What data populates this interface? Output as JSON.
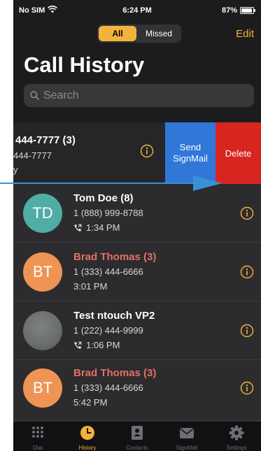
{
  "status": {
    "carrier": "No SIM",
    "time": "6:24 PM",
    "battery": "87%"
  },
  "header": {
    "segment_all": "All",
    "segment_missed": "Missed",
    "edit": "Edit",
    "title": "Call History"
  },
  "search": {
    "placeholder": "Search",
    "value": ""
  },
  "swiped_row": {
    "name": "444-7777 (3)",
    "number": "444-7777",
    "meta": "y",
    "send_label_1": "Send",
    "send_label_2": "SignMail",
    "delete_label": "Delete"
  },
  "calls": [
    {
      "initials": "TD",
      "name": "Tom Doe (8)",
      "number": "1 (888) 999-8788",
      "time": "1:34 PM",
      "missed": false,
      "outgoing": true,
      "avatar_color": "#4fada6"
    },
    {
      "initials": "BT",
      "name": "Brad Thomas (3)",
      "number": "1 (333) 444-6666",
      "time": "3:01 PM",
      "missed": true,
      "outgoing": false,
      "avatar_color": "#ef9455"
    },
    {
      "initials": "",
      "name": "Test ntouch VP2",
      "number": "1 (222) 444-9999",
      "time": "1:06 PM",
      "missed": false,
      "outgoing": true,
      "avatar_color": "#6a6e6b"
    },
    {
      "initials": "BT",
      "name": "Brad Thomas (3)",
      "number": "1 (333) 444-6666",
      "time": "5:42 PM",
      "missed": true,
      "outgoing": false,
      "avatar_color": "#ef9455"
    }
  ],
  "tabs": [
    {
      "label": "Dial",
      "icon": "dialpad-icon",
      "active": false
    },
    {
      "label": "History",
      "icon": "clock-icon",
      "active": true
    },
    {
      "label": "Contacts",
      "icon": "contacts-icon",
      "active": false
    },
    {
      "label": "SignMail",
      "icon": "envelope-icon",
      "active": false
    },
    {
      "label": "Settings",
      "icon": "gear-icon",
      "active": false
    }
  ],
  "colors": {
    "accent": "#f2b33d",
    "missed": "#e46f66",
    "send_button": "#3077d8",
    "delete_button": "#d7261f",
    "callout_arrow": "#3a8fd9"
  }
}
